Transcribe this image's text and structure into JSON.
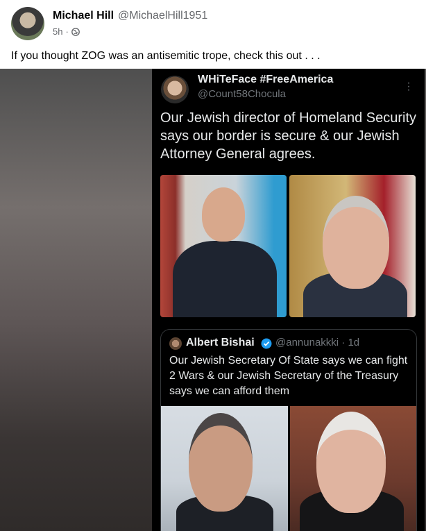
{
  "post": {
    "author_name": "Michael Hill",
    "author_handle": "@MichaelHill1951",
    "timestamp": "5h",
    "separator": "·",
    "audience_icon": "globe-icon",
    "caption": "If you thought ZOG was an antisemitic trope, check this out . . ."
  },
  "tweet": {
    "name": "WHiTeFace #FreeAmerica",
    "handle": "@Count58Chocula",
    "more_icon": "more-vertical-icon",
    "text": "Our Jewish director of Homeland Security says our border is secure & our Jewish Attorney General agrees.",
    "quote": {
      "name": "Albert Bishai",
      "verified_icon": "verified-badge-icon",
      "handle_time": "@annunakkki · 1d",
      "text": "Our Jewish Secretary Of State says we can fight 2 Wars & our Jewish Secretary of the Treasury says we can afford them"
    }
  },
  "colors": {
    "tweet_bg": "#000000",
    "text_primary": "#e7e9ea",
    "text_secondary": "#71767b",
    "verified_blue": "#1d9bf0",
    "fb_secondary": "#65676b"
  }
}
